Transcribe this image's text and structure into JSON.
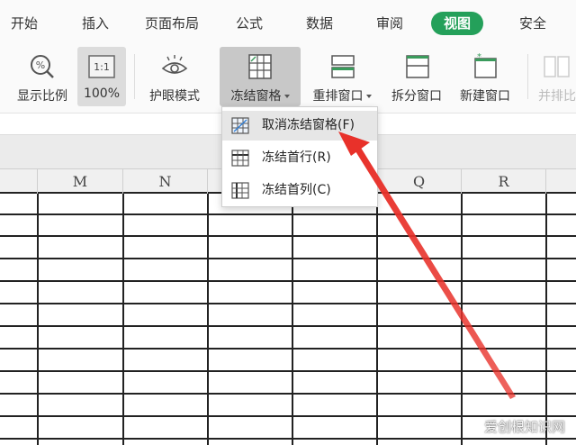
{
  "menu": {
    "tabs": [
      "开始",
      "插入",
      "页面布局",
      "公式",
      "数据",
      "审阅",
      "视图",
      "安全"
    ],
    "active": "视图"
  },
  "ribbon": {
    "zoom_label": "显示比例",
    "zoom_100_icon_text": "1:1",
    "zoom_100_label": "100%",
    "eye_label": "护眼模式",
    "freeze_label": "冻结窗格",
    "rearrange_label": "重排窗口",
    "split_label": "拆分窗口",
    "new_window_label": "新建窗口",
    "side_by_side_label": "并排比"
  },
  "freeze_menu": {
    "items": [
      {
        "label": "取消冻结窗格(F)",
        "icon": "unfreeze-icon"
      },
      {
        "label": "冻结首行(R)",
        "icon": "freeze-row-icon"
      },
      {
        "label": "冻结首列(C)",
        "icon": "freeze-column-icon"
      }
    ]
  },
  "sheet": {
    "columns": [
      "M",
      "N",
      "",
      "",
      "Q",
      "R",
      ""
    ]
  },
  "watermark": "爱创根知识网",
  "colors": {
    "accent": "#24a05a",
    "arrow": "#e8312a",
    "grid": "#222222"
  }
}
